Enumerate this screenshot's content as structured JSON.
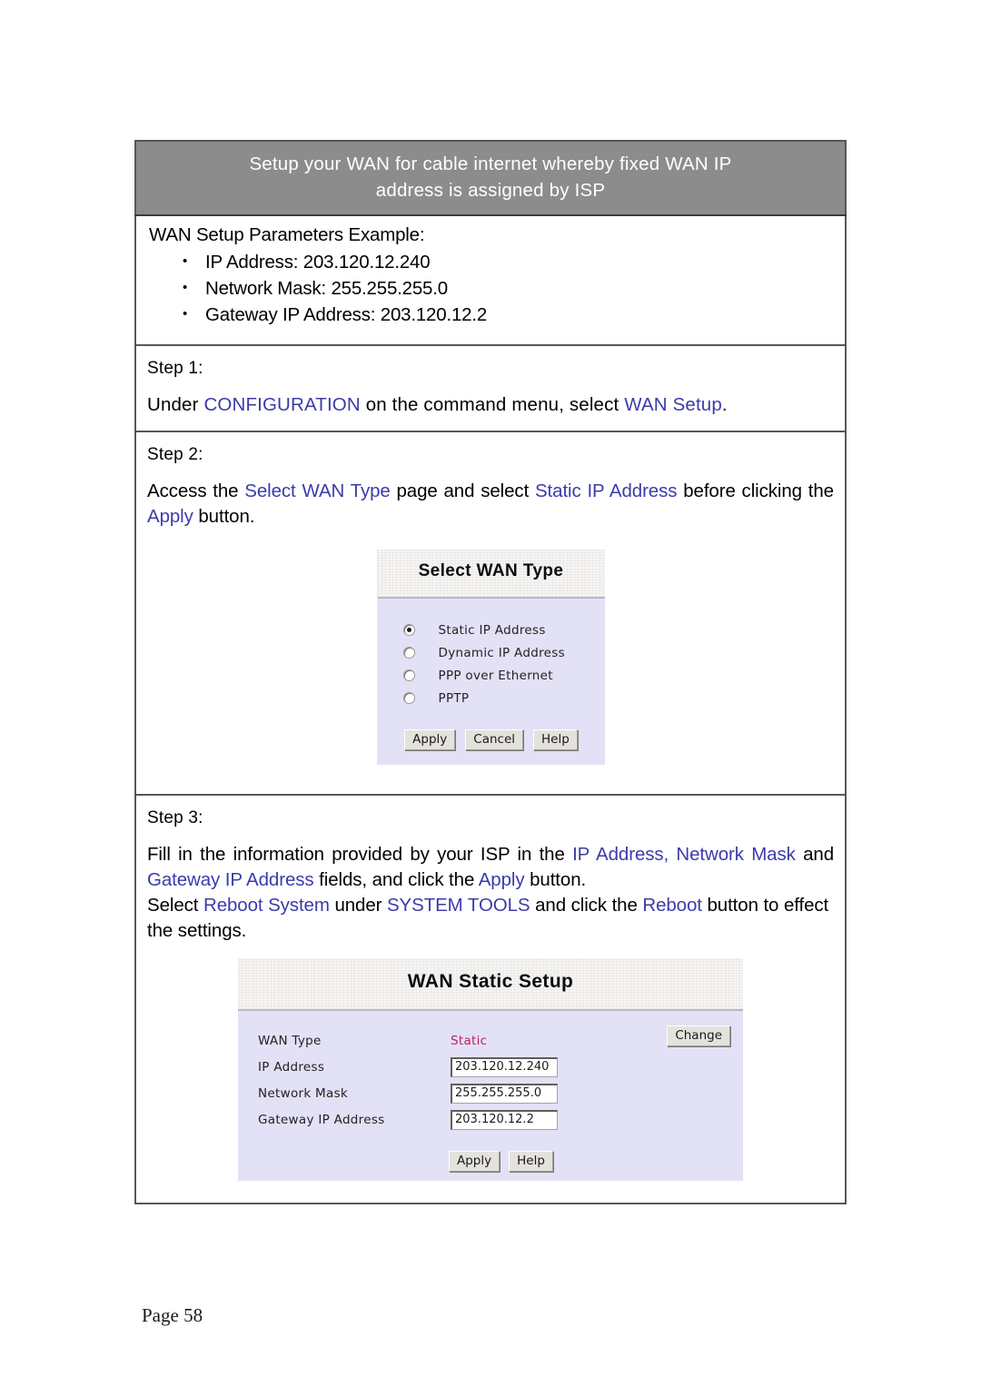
{
  "banner": {
    "line1": "Setup your WAN for cable internet whereby fixed WAN IP",
    "line2": "address is assigned by ISP"
  },
  "parameters": {
    "title": "WAN Setup Parameters Example:",
    "items": [
      "IP Address: 203.120.12.240",
      "Network Mask: 255.255.255.0",
      "Gateway IP Address: 203.120.12.2"
    ]
  },
  "step1": {
    "label": "Step 1:",
    "text_a": "Under ",
    "link_config": "CONFIGURATION",
    "text_b": " on the command menu, select ",
    "link_wan_setup": "WAN Setup",
    "text_c": "."
  },
  "step2": {
    "label": "Step 2:",
    "text_a": "Access the ",
    "link_select_wan_type": "Select WAN Type",
    "text_b": " page and select ",
    "link_static_ip": "Static IP Address",
    "text_c": " before clicking the ",
    "link_apply": "Apply",
    "text_d": " button."
  },
  "step3": {
    "label": "Step 3:",
    "text_a": "Fill in the information provided by your ISP in the ",
    "link_ip_address": "IP Address, Network Mask",
    "text_b": " and ",
    "link_gateway": "Gateway IP Address",
    "text_c": " fields, and click the ",
    "link_apply": "Apply",
    "text_d": " button.",
    "text_e": "Select ",
    "link_reboot_system": "Reboot System",
    "text_f": " under ",
    "link_system_tools": "SYSTEM TOOLS",
    "text_g": " and click the ",
    "link_reboot": "Reboot",
    "text_h": " button to effect the settings."
  },
  "select_wan_type_dialog": {
    "title": "Select WAN Type",
    "options": [
      {
        "label": "Static IP Address",
        "selected": true
      },
      {
        "label": "Dynamic IP Address",
        "selected": false
      },
      {
        "label": "PPP over Ethernet",
        "selected": false
      },
      {
        "label": "PPTP",
        "selected": false
      }
    ],
    "buttons": [
      "Apply",
      "Cancel",
      "Help"
    ]
  },
  "wan_static_setup_dialog": {
    "title": "WAN Static Setup",
    "wan_type_label": "WAN Type",
    "wan_type_value": "Static",
    "change_button": "Change",
    "fields": [
      {
        "label": "IP Address",
        "value": "203.120.12.240"
      },
      {
        "label": "Network Mask",
        "value": "255.255.255.0"
      },
      {
        "label": "Gateway IP Address",
        "value": "203.120.12.2"
      }
    ],
    "buttons": [
      "Apply",
      "Help"
    ]
  },
  "footer": {
    "page": "Page 58"
  },
  "colors": {
    "banner_bg": "#8c8c8c",
    "link_blue": "#3b3bab",
    "dialog_body": "#e2e1f6",
    "static_value_red": "#c0205a",
    "border": "#57555c"
  }
}
